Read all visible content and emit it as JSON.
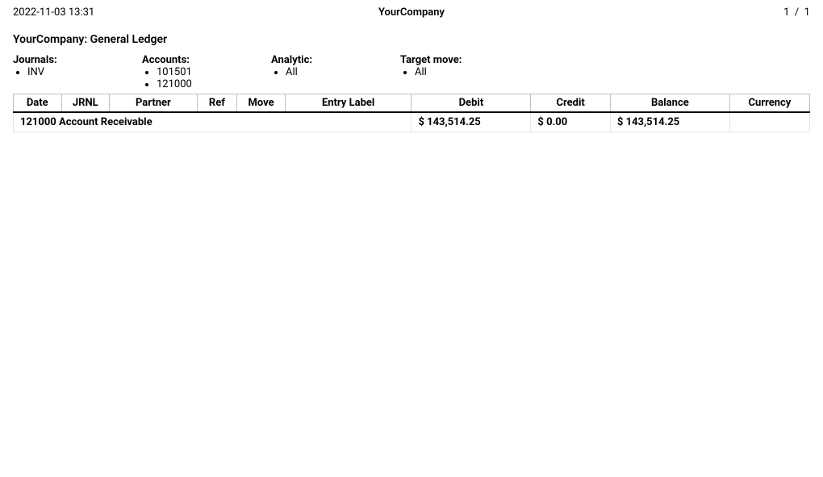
{
  "header": {
    "timestamp": "2022-11-03 13:31",
    "company": "YourCompany",
    "page_current": "1",
    "page_sep": "/",
    "page_total": "1"
  },
  "report": {
    "title": "YourCompany: General Ledger"
  },
  "filters": {
    "journals": {
      "label": "Journals:",
      "items": [
        "INV"
      ]
    },
    "accounts": {
      "label": "Accounts:",
      "items": [
        "101501",
        "121000"
      ]
    },
    "analytic": {
      "label": "Analytic:",
      "items": [
        "All"
      ]
    },
    "target_move": {
      "label": "Target move:",
      "items": [
        "All"
      ]
    }
  },
  "table": {
    "headers": {
      "date": "Date",
      "jrnl": "JRNL",
      "partner": "Partner",
      "ref": "Ref",
      "move": "Move",
      "entry_label": "Entry Label",
      "debit": "Debit",
      "credit": "Credit",
      "balance": "Balance",
      "currency": "Currency"
    },
    "rows": [
      {
        "account": "121000 Account Receivable",
        "debit": "$ 143,514.25",
        "credit": "$ 0.00",
        "balance": "$ 143,514.25",
        "currency": ""
      }
    ]
  }
}
